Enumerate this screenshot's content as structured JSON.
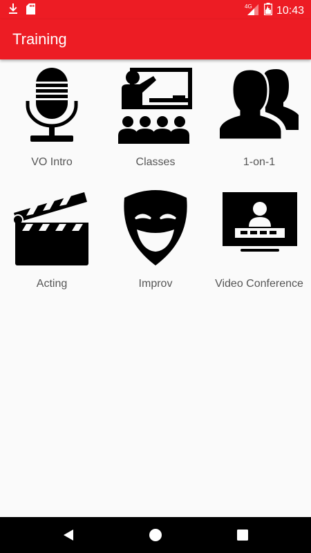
{
  "status_bar": {
    "time": "10:43",
    "network": "4G",
    "icons": [
      "download-icon",
      "sd-card-icon",
      "signal-icon",
      "battery-icon"
    ]
  },
  "app_bar": {
    "title": "Training",
    "color": "#ed1c24"
  },
  "tiles": [
    {
      "label": "VO Intro",
      "icon": "microphone-icon"
    },
    {
      "label": "Classes",
      "icon": "classroom-icon"
    },
    {
      "label": "1-on-1",
      "icon": "two-people-icon"
    },
    {
      "label": "Acting",
      "icon": "clapperboard-icon"
    },
    {
      "label": "Improv",
      "icon": "theater-mask-icon"
    },
    {
      "label": "Video Conference",
      "icon": "video-conference-icon"
    }
  ],
  "nav_bar": {
    "icons": [
      "back-icon",
      "home-icon",
      "recents-icon"
    ]
  }
}
